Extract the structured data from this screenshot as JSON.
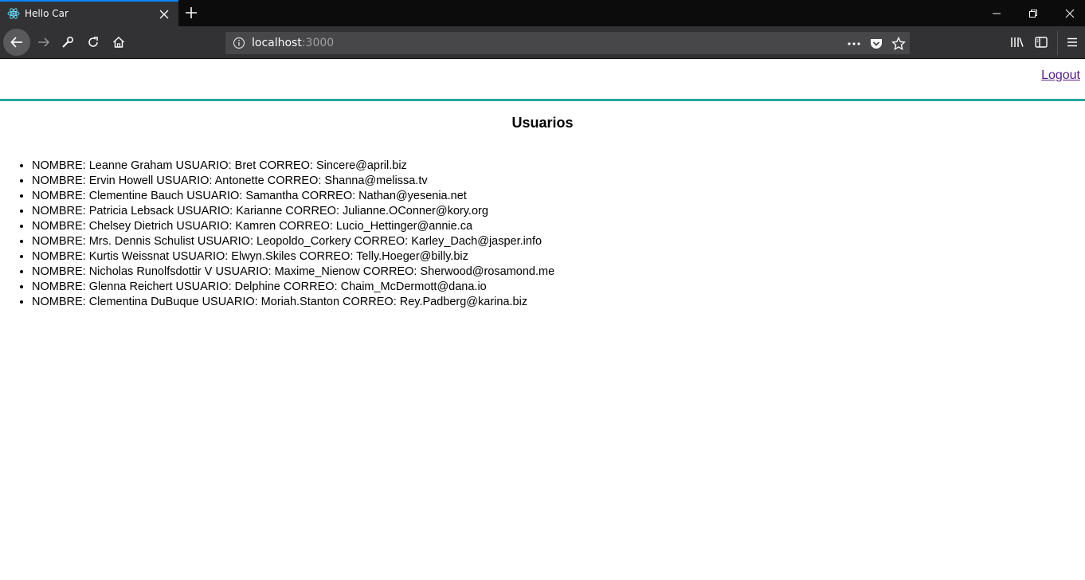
{
  "browser": {
    "tab_title": "Hello Car",
    "url_host": "localhost",
    "url_port": ":3000"
  },
  "page": {
    "logout_label": "Logout",
    "heading": "Usuarios",
    "users": [
      "NOMBRE: Leanne Graham USUARIO: Bret CORREO: Sincere@april.biz",
      "NOMBRE: Ervin Howell USUARIO: Antonette CORREO: Shanna@melissa.tv",
      "NOMBRE: Clementine Bauch USUARIO: Samantha CORREO: Nathan@yesenia.net",
      "NOMBRE: Patricia Lebsack USUARIO: Karianne CORREO: Julianne.OConner@kory.org",
      "NOMBRE: Chelsey Dietrich USUARIO: Kamren CORREO: Lucio_Hettinger@annie.ca",
      "NOMBRE: Mrs. Dennis Schulist USUARIO: Leopoldo_Corkery CORREO: Karley_Dach@jasper.info",
      "NOMBRE: Kurtis Weissnat USUARIO: Elwyn.Skiles CORREO: Telly.Hoeger@billy.biz",
      "NOMBRE: Nicholas Runolfsdottir V USUARIO: Maxime_Nienow CORREO: Sherwood@rosamond.me",
      "NOMBRE: Glenna Reichert USUARIO: Delphine CORREO: Chaim_McDermott@dana.io",
      "NOMBRE: Clementina DuBuque USUARIO: Moriah.Stanton CORREO: Rey.Padberg@karina.biz"
    ]
  },
  "colors": {
    "accent_line": "#26a69a",
    "tab_highlight": "#0a84ff",
    "chrome_dark": "#0c0c0d",
    "chrome": "#323234",
    "link_visited": "#551a8b"
  },
  "icons": {
    "tab": "react-atom-icon",
    "close": "close-icon",
    "new_tab": "plus-icon",
    "back": "back-arrow-icon",
    "forward": "forward-arrow-icon",
    "tools": "wrench-icon",
    "reload": "reload-icon",
    "home": "home-icon",
    "info": "info-icon",
    "more": "more-dots-icon",
    "pocket": "pocket-icon",
    "bookmark": "star-icon",
    "library": "library-icon",
    "sidebar": "sidebar-icon",
    "menu": "hamburger-menu-icon"
  }
}
